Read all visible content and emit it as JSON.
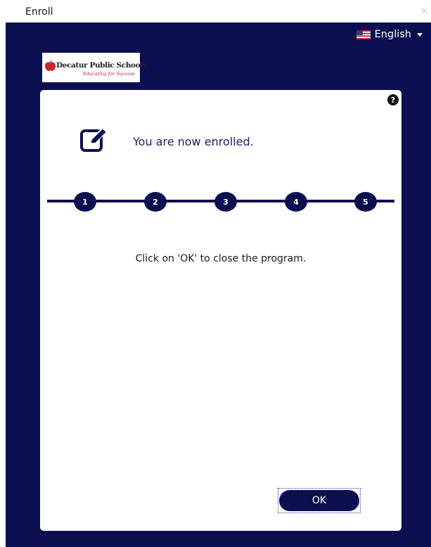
{
  "window": {
    "title": "Enroll",
    "close_glyph": "×"
  },
  "language": {
    "selected": "English",
    "flag_icon": "us-flag-icon"
  },
  "logo": {
    "name": "Decatur Public Schools",
    "tagline": "Educating for Success"
  },
  "help": {
    "glyph": "?"
  },
  "heading": {
    "text": "You are now enrolled.",
    "icon": "edit-icon"
  },
  "steps": [
    "1",
    "2",
    "3",
    "4",
    "5"
  ],
  "message": "Click on 'OK' to close the program.",
  "buttons": {
    "ok": "OK"
  },
  "colors": {
    "navy": "#0c0f4f",
    "heading_text": "#1a1f5e",
    "card": "#ffffff",
    "tagline_red": "#b0262a"
  }
}
